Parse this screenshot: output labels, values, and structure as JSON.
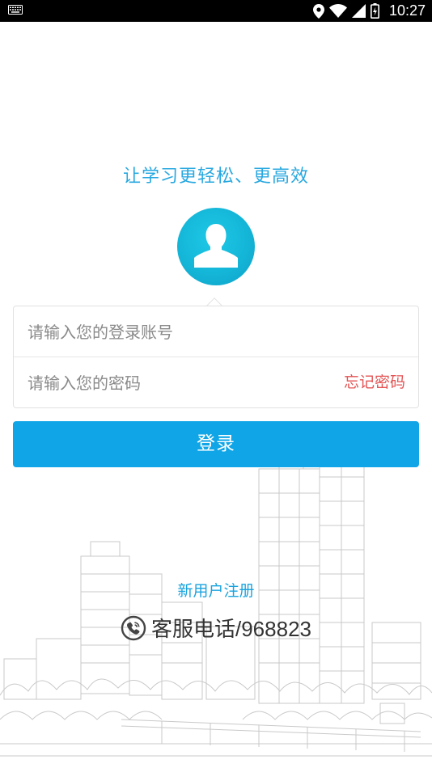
{
  "status_bar": {
    "time": "10:27",
    "icons": [
      "keyboard-icon",
      "location-icon",
      "wifi-icon",
      "signal-icon",
      "battery-icon"
    ]
  },
  "login": {
    "slogan": "让学习更轻松、更高效",
    "account_placeholder": "请输入您的登录账号",
    "password_placeholder": "请输入您的密码",
    "forgot_password": "忘记密码",
    "login_button": "登录",
    "register_link": "新用户注册",
    "hotline": "客服电话/968823"
  },
  "colors": {
    "accent": "#0fa5e6",
    "slogan": "#28a8e0",
    "forgot": "#e35454",
    "avatar": "#14b6d8"
  }
}
